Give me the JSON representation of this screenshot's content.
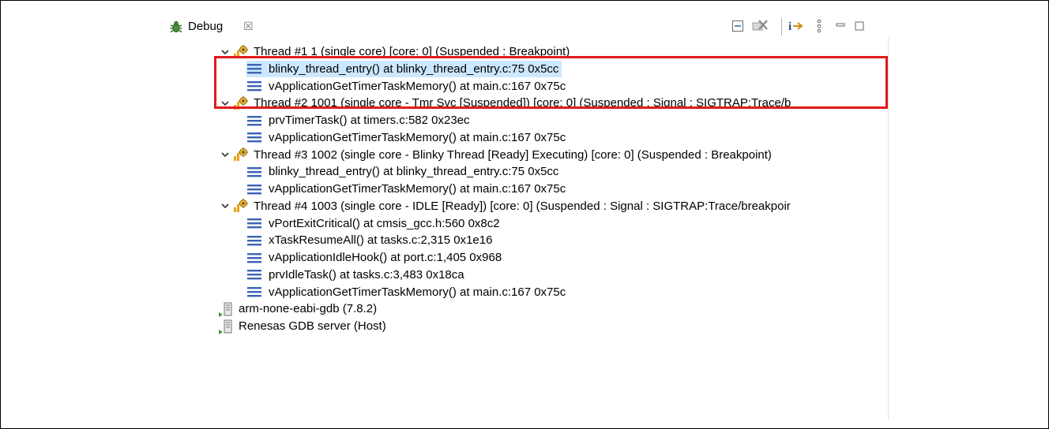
{
  "view": {
    "title": "Debug",
    "close_glyph": "☒",
    "toolbar": [
      {
        "name": "collapse-all-icon"
      },
      {
        "name": "remove-terminated-icon"
      },
      {
        "name": "step-into-selection-icon"
      },
      {
        "name": "view-menu-icon"
      },
      {
        "name": "minimize-icon"
      },
      {
        "name": "maximize-icon"
      }
    ]
  },
  "tree": {
    "threads": [
      {
        "label": "Thread #1 1 (single core) [core: 0] (Suspended : Breakpoint)",
        "frames": [
          {
            "label": "blinky_thread_entry() at blinky_thread_entry.c:75 0x5cc",
            "selected": true
          },
          {
            "label": "vApplicationGetTimerTaskMemory() at main.c:167 0x75c"
          }
        ]
      },
      {
        "label": "Thread #2 1001 (single core - Tmr Svc [Suspended]) [core: 0] (Suspended : Signal : SIGTRAP:Trace/b",
        "frames": [
          {
            "label": "prvTimerTask() at timers.c:582 0x23ec"
          },
          {
            "label": "vApplicationGetTimerTaskMemory() at main.c:167 0x75c"
          }
        ]
      },
      {
        "label": "Thread #3 1002 (single core - Blinky Thread [Ready] Executing) [core: 0] (Suspended : Breakpoint)",
        "frames": [
          {
            "label": "blinky_thread_entry() at blinky_thread_entry.c:75 0x5cc"
          },
          {
            "label": "vApplicationGetTimerTaskMemory() at main.c:167 0x75c"
          }
        ]
      },
      {
        "label": "Thread #4 1003 (single core - IDLE [Ready]) [core: 0] (Suspended : Signal : SIGTRAP:Trace/breakpoir",
        "frames": [
          {
            "label": "vPortExitCritical() at cmsis_gcc.h:560 0x8c2"
          },
          {
            "label": "xTaskResumeAll() at tasks.c:2,315 0x1e16"
          },
          {
            "label": "vApplicationIdleHook() at port.c:1,405 0x968"
          },
          {
            "label": "prvIdleTask() at tasks.c:3,483 0x18ca"
          },
          {
            "label": "vApplicationGetTimerTaskMemory() at main.c:167 0x75c"
          }
        ]
      }
    ],
    "processes": [
      {
        "label": "arm-none-eabi-gdb (7.8.2)"
      },
      {
        "label": "Renesas GDB server (Host)"
      }
    ]
  },
  "highlight_color": "#e11b1b"
}
